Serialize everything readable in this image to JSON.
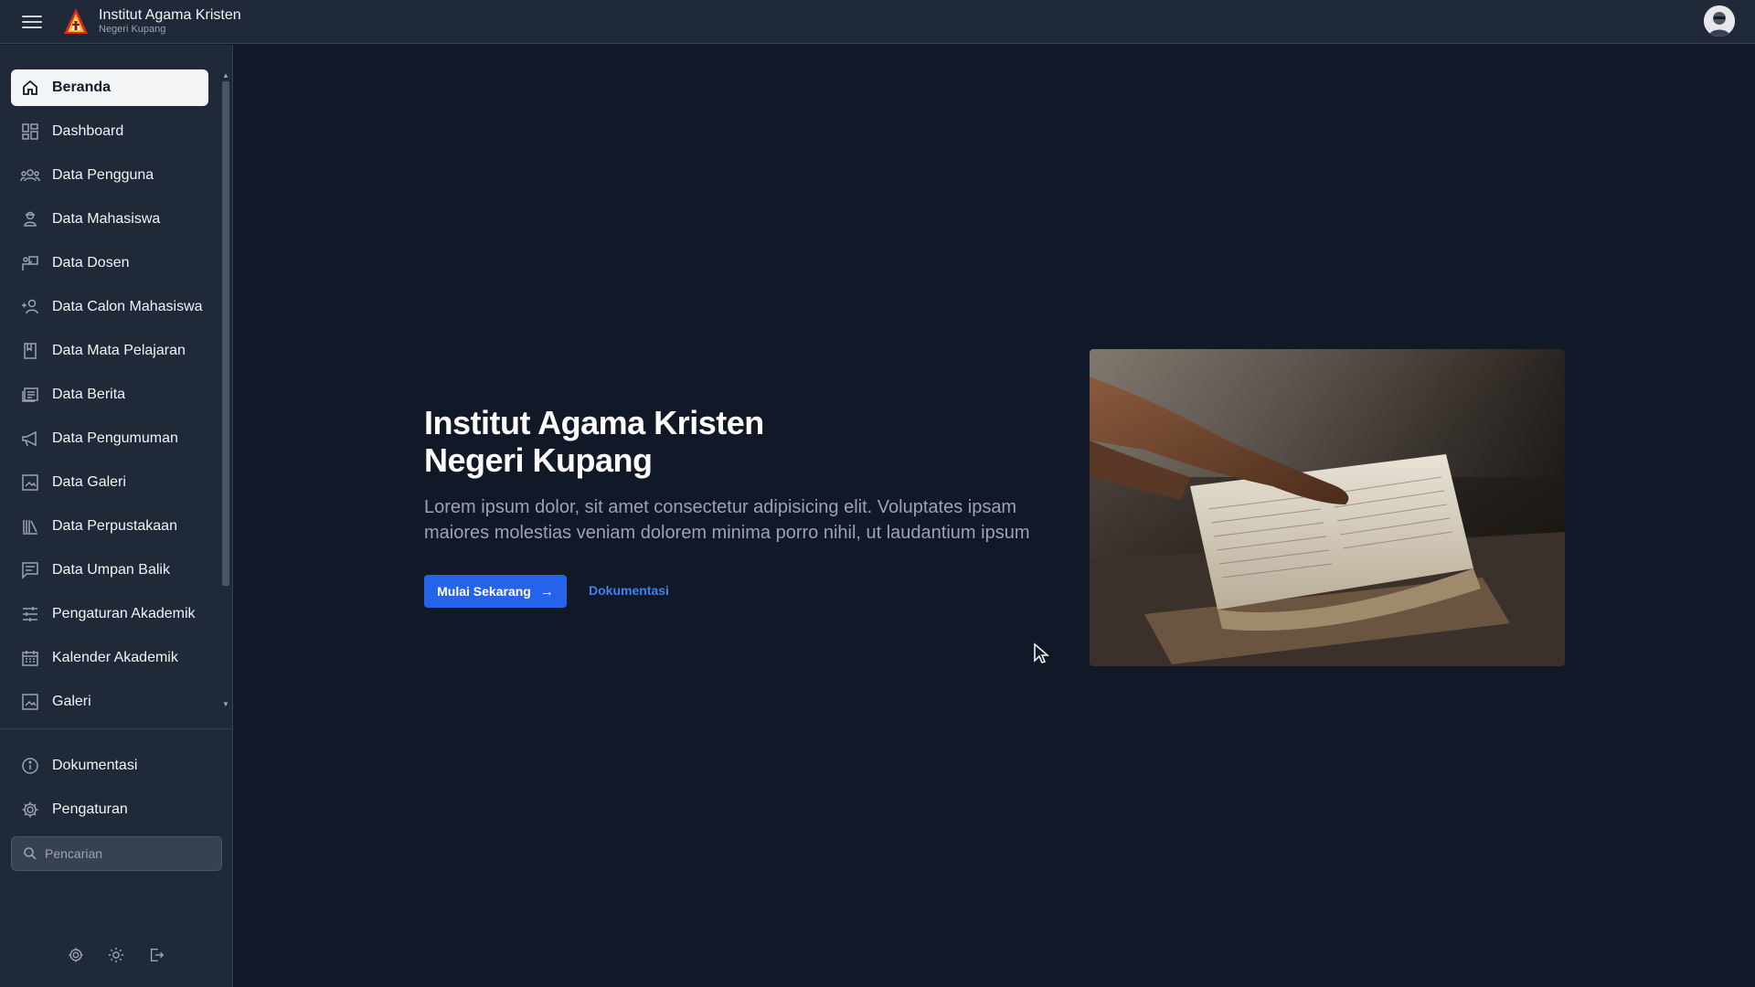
{
  "header": {
    "title": "Institut Agama Kristen",
    "subtitle": "Negeri Kupang",
    "menu_icon": "hamburger-icon",
    "avatar_icon": "user-avatar"
  },
  "sidebar": {
    "items": [
      {
        "label": "Beranda",
        "icon": "home-icon",
        "active": true
      },
      {
        "label": "Dashboard",
        "icon": "dashboard-icon"
      },
      {
        "label": "Data Pengguna",
        "icon": "users-icon"
      },
      {
        "label": "Data Mahasiswa",
        "icon": "student-icon"
      },
      {
        "label": "Data Dosen",
        "icon": "lecturer-icon"
      },
      {
        "label": "Data Calon Mahasiswa",
        "icon": "add-user-icon"
      },
      {
        "label": "Data Mata Pelajaran",
        "icon": "book-icon"
      },
      {
        "label": "Data Berita",
        "icon": "news-icon"
      },
      {
        "label": "Data Pengumuman",
        "icon": "megaphone-icon"
      },
      {
        "label": "Data Galeri",
        "icon": "image-icon"
      },
      {
        "label": "Data Perpustakaan",
        "icon": "library-icon"
      },
      {
        "label": "Data Umpan Balik",
        "icon": "feedback-icon"
      },
      {
        "label": "Pengaturan Akademik",
        "icon": "sliders-icon"
      },
      {
        "label": "Kalender Akademik",
        "icon": "calendar-icon"
      },
      {
        "label": "Galeri",
        "icon": "image-icon"
      }
    ],
    "footer_items": [
      {
        "label": "Dokumentasi",
        "icon": "info-icon"
      },
      {
        "label": "Pengaturan",
        "icon": "gear-icon"
      }
    ],
    "search": {
      "placeholder": "Pencarian"
    },
    "bottom_icons": [
      "settings-icon",
      "sun-icon",
      "logout-icon"
    ]
  },
  "hero": {
    "title_line1": "Institut Agama Kristen",
    "title_line2": "Negeri Kupang",
    "text_line1": "Lorem ipsum dolor, sit amet consectetur adipisicing elit. Voluptates ipsam",
    "text_line2": "maiores molestias veniam dolorem minima porro nihil, ut laudantium ipsum",
    "primary_button": "Mulai Sekarang",
    "secondary_link": "Dokumentasi"
  },
  "colors": {
    "background": "#111827",
    "sidebar": "#1f2937",
    "accent": "#2563eb",
    "link": "#3b82f6"
  }
}
